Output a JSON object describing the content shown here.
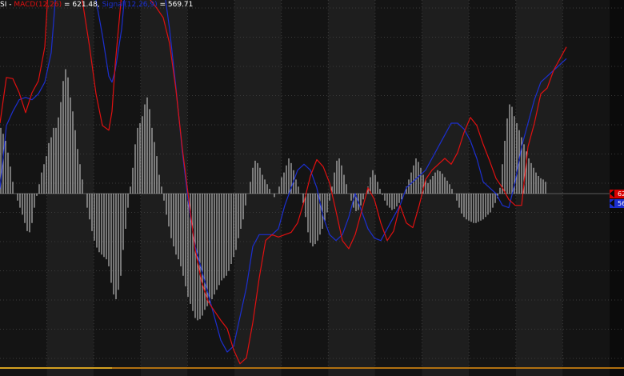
{
  "legend": {
    "prefix": "SI - ",
    "macd_label": "MACD(12,26)",
    "macd_value": " = 621.48,",
    "signal_label": " Signal(12,26,9)",
    "signal_value": " = 569.71"
  },
  "tags": {
    "macd": "621",
    "signal": "569"
  },
  "colors": {
    "background": "#0b0b0b",
    "band_a": "#1e1e1e",
    "band_b": "#141414",
    "grid": "#3a3a3a",
    "macd": "#e01010",
    "signal": "#1c2fd0",
    "histogram": "#d8d8d8",
    "bottom_strip": "#d4a020"
  },
  "chart_data": {
    "type": "line",
    "title": "",
    "bands": 13,
    "ylim": [
      -1500,
      1650
    ],
    "x": [
      0,
      8,
      16,
      24,
      32,
      40,
      48,
      56,
      64,
      72,
      76,
      80,
      84,
      88,
      96,
      104,
      112,
      120,
      128,
      136,
      140,
      144,
      152,
      160,
      168,
      172,
      176,
      180,
      188,
      196,
      204,
      212,
      220,
      228,
      236,
      244,
      252,
      260,
      268,
      276,
      284,
      292,
      300,
      308,
      316,
      324,
      332,
      340,
      348,
      356,
      364,
      372,
      380,
      388,
      396,
      404,
      412,
      420,
      428,
      436,
      444,
      452,
      460,
      468,
      476,
      484,
      492,
      500,
      508,
      516,
      524,
      532,
      540,
      548,
      556,
      564,
      572,
      580,
      588,
      596,
      604,
      612,
      620,
      628,
      636,
      644,
      652,
      660,
      668,
      676,
      684,
      692,
      700,
      708,
      716,
      724,
      732
    ],
    "series": [
      {
        "name": "MACD(12,26)",
        "color": "#e01010",
        "values": [
          600,
          990,
          980,
          860,
          690,
          860,
          960,
          1250,
          2200,
          2870,
          2980,
          2900,
          2600,
          2150,
          1900,
          1600,
          1250,
          850,
          580,
          540,
          700,
          1100,
          1700,
          2450,
          2800,
          2820,
          2650,
          2200,
          1650,
          1580,
          1500,
          1280,
          880,
          380,
          -50,
          -480,
          -750,
          -920,
          -1000,
          -1080,
          -1150,
          -1330,
          -1450,
          -1400,
          -1100,
          -720,
          -400,
          -350,
          -370,
          -350,
          -330,
          -250,
          -70,
          150,
          290,
          230,
          90,
          -150,
          -400,
          -470,
          -350,
          -150,
          50,
          -50,
          -250,
          -400,
          -320,
          -100,
          -250,
          -290,
          -100,
          120,
          200,
          250,
          300,
          250,
          350,
          520,
          650,
          580,
          420,
          280,
          130,
          50,
          -50,
          -100,
          -100,
          400,
          600,
          850,
          900,
          1050,
          1150,
          1250
        ],
        "note": ""
      },
      {
        "name": "Signal(12,26,9)",
        "color": "#1c2fd0",
        "values": [
          40,
          580,
          700,
          800,
          820,
          800,
          850,
          950,
          1200,
          1900,
          2300,
          2500,
          2500,
          2400,
          2250,
          2050,
          1850,
          1650,
          1350,
          1000,
          950,
          1050,
          1400,
          2000,
          2350,
          2500,
          2450,
          2350,
          2150,
          1950,
          1800,
          1400,
          900,
          350,
          -100,
          -450,
          -650,
          -850,
          -1050,
          -1250,
          -1350,
          -1300,
          -1050,
          -800,
          -450,
          -350,
          -350,
          -350,
          -300,
          -100,
          50,
          200,
          250,
          200,
          50,
          -200,
          -350,
          -400,
          -350,
          -200,
          0,
          -150,
          -300,
          -380,
          -400,
          -300,
          -200,
          -100,
          50,
          100,
          150,
          200,
          300,
          400,
          500,
          600,
          600,
          550,
          450,
          300,
          100,
          50,
          0,
          -100,
          -120,
          100,
          400,
          600,
          800,
          950,
          1000,
          1050,
          1100,
          1150
        ],
        "note": ""
      }
    ],
    "histogram": {
      "name": "MACD histogram",
      "x_start": 0,
      "x_step": 3,
      "values": [
        560,
        510,
        450,
        350,
        230,
        100,
        0,
        -60,
        -120,
        -180,
        -250,
        -320,
        -330,
        -250,
        -120,
        -20,
        80,
        180,
        250,
        320,
        430,
        480,
        560,
        560,
        650,
        780,
        960,
        1060,
        990,
        820,
        700,
        540,
        380,
        250,
        120,
        0,
        -120,
        -220,
        -320,
        -400,
        -460,
        -500,
        -520,
        -540,
        -560,
        -620,
        -760,
        -860,
        -900,
        -820,
        -700,
        -480,
        -300,
        -120,
        60,
        220,
        420,
        560,
        600,
        660,
        760,
        820,
        720,
        560,
        440,
        320,
        160,
        60,
        -60,
        -180,
        -280,
        -380,
        -450,
        -520,
        -560,
        -620,
        -700,
        -790,
        -880,
        -940,
        -1000,
        -1060,
        -1080,
        -1070,
        -1040,
        -990,
        -960,
        -930,
        -900,
        -860,
        -820,
        -780,
        -740,
        -720,
        -700,
        -660,
        -600,
        -540,
        -480,
        -380,
        -300,
        -220,
        -100,
        0,
        100,
        220,
        280,
        260,
        220,
        160,
        120,
        80,
        40,
        0,
        -30,
        0,
        60,
        140,
        180,
        240,
        300,
        260,
        200,
        120,
        60,
        0,
        -80,
        -200,
        -330,
        -420,
        -450,
        -430,
        -400,
        -350,
        -300,
        -240,
        -160,
        -60,
        60,
        180,
        280,
        300,
        240,
        160,
        80,
        0,
        -60,
        -120,
        -150,
        -140,
        -100,
        -50,
        0,
        60,
        140,
        200,
        160,
        100,
        40,
        -10,
        -60,
        -100,
        -120,
        -140,
        -130,
        -110,
        -80,
        -50,
        0,
        60,
        120,
        180,
        240,
        300,
        270,
        220,
        160,
        120,
        90,
        120,
        150,
        180,
        200,
        190,
        170,
        140,
        110,
        80,
        40,
        0,
        -60,
        -120,
        -170,
        -200,
        -220,
        -230,
        -240,
        -250,
        -250,
        -240,
        -230,
        -220,
        -200,
        -180,
        -160,
        -120,
        -80,
        -40,
        50,
        250,
        450,
        640,
        760,
        740,
        660,
        600,
        540,
        480,
        420,
        360,
        300,
        260,
        220,
        180,
        150,
        130,
        120,
        100
      ]
    }
  }
}
